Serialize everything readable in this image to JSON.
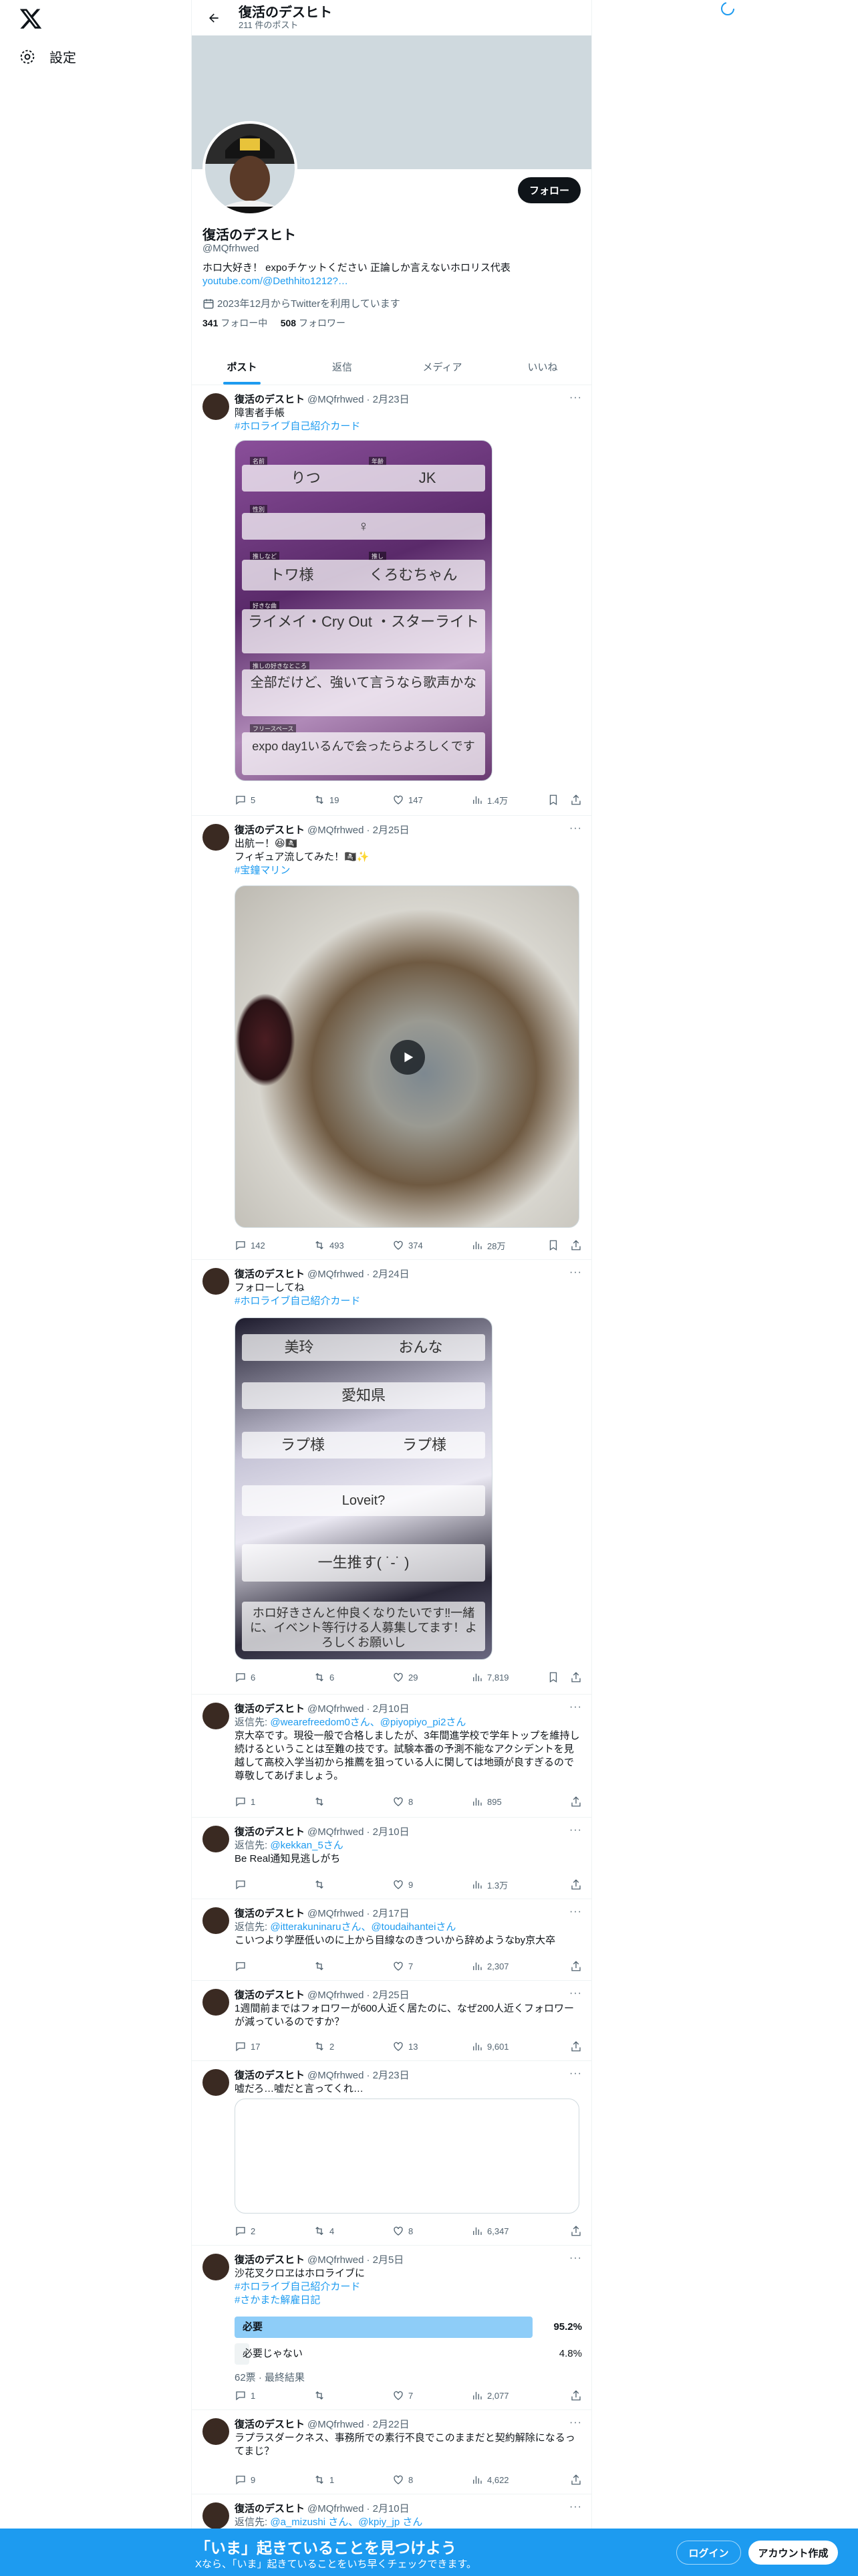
{
  "nav": {
    "settings_label": "設定"
  },
  "header": {
    "title": "復活のデスヒト",
    "post_count": "211 件のポスト"
  },
  "profile": {
    "name": "復活のデスヒト",
    "handle": "@MQfrhwed",
    "bio": "ホロ大好き！ expoチケットください 正論しか言えないホロリス代表",
    "link": "youtube.com/@Dethhito1212?…",
    "joined": "2023年12月からTwitterを利用しています",
    "following_count": "341",
    "following_label": "フォロー中",
    "followers_count": "508",
    "followers_label": "フォロワー",
    "follow_button": "フォロー"
  },
  "tabs": [
    "ポスト",
    "返信",
    "メディア",
    "いいね"
  ],
  "tweets": [
    {
      "name": "復活のデスヒト",
      "handle": "@MQfrhwed",
      "date": "· 2月23日",
      "text": "障害者手帳",
      "hashtag": "#ホロライブ自己紹介カード",
      "card_labels": [
        "名前",
        "年齢",
        "性別",
        "推しなど",
        "推し",
        "好きな曲",
        "推しの好きなところ",
        "フリースペース"
      ],
      "card_values": [
        "りつ",
        "JK",
        "♀",
        "トワ様",
        "くろむちゃん",
        "ライメイ・Cry Out ・スターライト",
        "全部だけど、強いて言うなら歌声かな",
        "expo day1いるんで会ったらよろしくです"
      ],
      "replies": "5",
      "reposts": "19",
      "likes": "147",
      "views": "1.4万"
    },
    {
      "name": "復活のデスヒト",
      "handle": "@MQfrhwed",
      "date": "· 2月25日",
      "text": "出航ー！😆🏴‍☠️\nフィギュア流してみた！🏴‍☠️✨",
      "hashtag": "#宝鐘マリン",
      "replies": "142",
      "reposts": "493",
      "likes": "374",
      "views": "28万"
    },
    {
      "name": "復活のデスヒト",
      "handle": "@MQfrhwed",
      "date": "· 2月24日",
      "text": "フォローしてね",
      "hashtag": "#ホロライブ自己紹介カード",
      "card_values": [
        "美玲",
        "おんな",
        "愛知県",
        "ラプ様",
        "ラプ様",
        "Loveit?",
        "一生推す( ˙-˙ )",
        "ホロ好きさんと仲良くなりたいです‼︎一緒に、イベント等行ける人募集してます！よろしくお願いし"
      ],
      "replies": "6",
      "reposts": "6",
      "likes": "29",
      "views": "7,819"
    },
    {
      "name": "復活のデスヒト",
      "handle": "@MQfrhwed",
      "date": "· 2月10日",
      "reply_prefix": "返信先: ",
      "reply_mentions": "@wearefreedom0さん、@piyopiyo_pi2さん",
      "text": "京大卒です。現役一般で合格しましたが、3年間進学校で学年トップを維持し続けるということは至難の技です。試験本番の予測不能なアクシデントを見越して高校入学当初から推薦を狙っている人に関しては地頭が良すぎるので尊敬してあげましょう。",
      "replies": "1",
      "reposts": "",
      "likes": "8",
      "views": "895"
    },
    {
      "name": "復活のデスヒト",
      "handle": "@MQfrhwed",
      "date": "· 2月10日",
      "reply_prefix": "返信先: ",
      "reply_mentions": "@kekkan_5さん",
      "text": "Be Real通知見逃しがち",
      "replies": "",
      "reposts": "",
      "likes": "9",
      "views": "1.3万"
    },
    {
      "name": "復活のデスヒト",
      "handle": "@MQfrhwed",
      "date": "· 2月17日",
      "reply_prefix": "返信先: ",
      "reply_mentions": "@itterakuninaruさん、@toudaihanteiさん",
      "text": "こいつより学歴低いのに上から目線なのきついから辞めようなby京大卒",
      "replies": "",
      "reposts": "",
      "likes": "7",
      "views": "2,307"
    },
    {
      "name": "復活のデスヒト",
      "handle": "@MQfrhwed",
      "date": "· 2月25日",
      "text": "1週間前まではフォロワーが600人近く居たのに、なぜ200人近くフォロワーが減っているのですか？",
      "replies": "17",
      "reposts": "2",
      "likes": "13",
      "views": "9,601"
    },
    {
      "name": "復活のデスヒト",
      "handle": "@MQfrhwed",
      "date": "· 2月23日",
      "text": "嘘だろ…嘘だと言ってくれ…",
      "replies": "2",
      "reposts": "4",
      "likes": "8",
      "views": "6,347"
    },
    {
      "name": "復活のデスヒト",
      "handle": "@MQfrhwed",
      "date": "· 2月5日",
      "text": "沙花叉クロヱはホロライブに",
      "hashtag": "#ホロライブ自己紹介カード",
      "hashtag2": "#さかまた解雇日記",
      "poll": [
        {
          "label": "必要",
          "pct": "95.2%",
          "share": 0.952
        },
        {
          "label": "必要じゃない",
          "pct": "4.8%",
          "share": 0.048
        }
      ],
      "poll_meta": "62票 · 最終結果",
      "replies": "1",
      "reposts": "",
      "likes": "7",
      "views": "2,077"
    },
    {
      "name": "復活のデスヒト",
      "handle": "@MQfrhwed",
      "date": "· 2月22日",
      "text": "ラプラスダークネス、事務所での素行不良でこのままだと契約解除になるってまじ？",
      "replies": "9",
      "reposts": "1",
      "likes": "8",
      "views": "4,622"
    },
    {
      "name": "復活のデスヒト",
      "handle": "@MQfrhwed",
      "date": "· 2月10日",
      "reply_prefix": "返信先: ",
      "reply_mentions": "@a_mizushi さん、@kpiy_jp さん"
    }
  ],
  "bottom_bar": {
    "title": "「いま」起きていることを見つけよう",
    "subtitle": "Xなら、「いま」起きていることをいち早くチェックできます。",
    "login": "ログイン",
    "signup": "アカウント作成"
  }
}
